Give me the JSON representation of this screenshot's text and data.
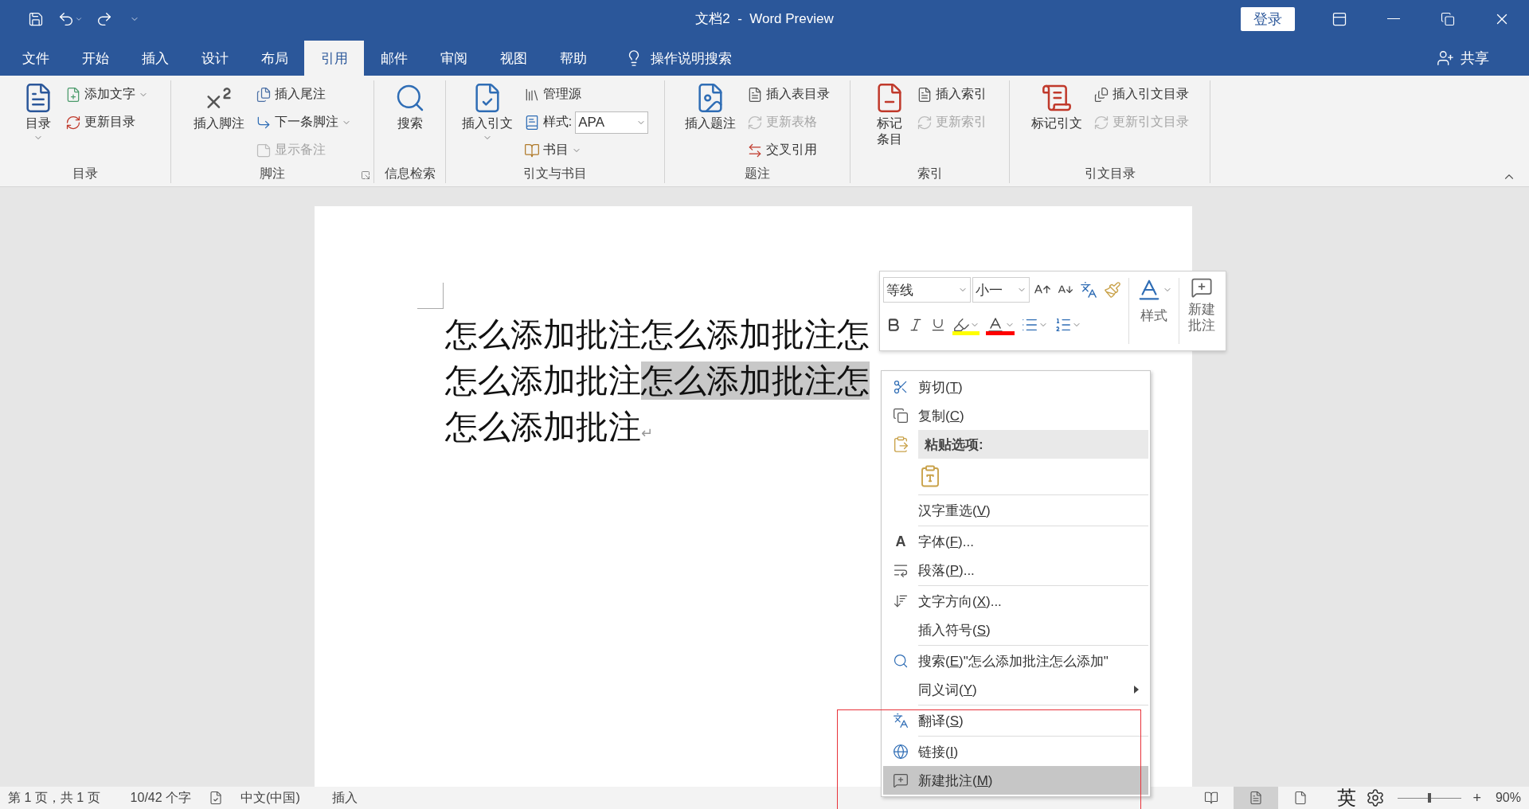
{
  "title_bar": {
    "title": "文档2  -  Word Preview",
    "sign_in": "登录"
  },
  "menu_tabs": [
    {
      "label": "文件",
      "selected": false
    },
    {
      "label": "开始",
      "selected": false
    },
    {
      "label": "插入",
      "selected": false
    },
    {
      "label": "设计",
      "selected": false
    },
    {
      "label": "布局",
      "selected": false
    },
    {
      "label": "引用",
      "selected": true
    },
    {
      "label": "邮件",
      "selected": false
    },
    {
      "label": "审阅",
      "selected": false
    },
    {
      "label": "视图",
      "selected": false
    },
    {
      "label": "帮助",
      "selected": false
    }
  ],
  "tell_me": "操作说明搜索",
  "share": "共享",
  "ribbon": {
    "groups": [
      {
        "label": "目录",
        "launcher": false,
        "items": [
          {
            "kind": "large",
            "label": "目录",
            "dropdown": true,
            "disabled": false
          },
          {
            "kind": "small",
            "label": "添加文字",
            "dropdown": true,
            "disabled": false
          },
          {
            "kind": "small",
            "label": "更新目录",
            "dropdown": false,
            "disabled": false
          }
        ]
      },
      {
        "label": "脚注",
        "launcher": true,
        "items": [
          {
            "kind": "large",
            "label": "插入脚注",
            "dropdown": false,
            "disabled": false
          },
          {
            "kind": "small",
            "label": "插入尾注",
            "dropdown": false,
            "disabled": false
          },
          {
            "kind": "small",
            "label": "下一条脚注",
            "dropdown": true,
            "disabled": false
          },
          {
            "kind": "small",
            "label": "显示备注",
            "dropdown": false,
            "disabled": true
          }
        ]
      },
      {
        "label": "信息检索",
        "launcher": false,
        "items": [
          {
            "kind": "large",
            "label": "搜索",
            "dropdown": false,
            "disabled": false
          }
        ]
      },
      {
        "label": "引文与书目",
        "launcher": false,
        "items": [
          {
            "kind": "large",
            "label": "插入引文",
            "dropdown": true,
            "disabled": false
          },
          {
            "kind": "small",
            "label": "管理源",
            "dropdown": false,
            "disabled": false
          },
          {
            "kind": "combo",
            "label": "样式:",
            "value": "APA",
            "dropdown": true,
            "disabled": false
          },
          {
            "kind": "small",
            "label": "书目",
            "dropdown": true,
            "disabled": false
          }
        ]
      },
      {
        "label": "题注",
        "launcher": false,
        "items": [
          {
            "kind": "large",
            "label": "插入题注",
            "dropdown": false,
            "disabled": false
          },
          {
            "kind": "small",
            "label": "插入表目录",
            "dropdown": false,
            "disabled": false
          },
          {
            "kind": "small",
            "label": "更新表格",
            "dropdown": false,
            "disabled": true
          },
          {
            "kind": "small",
            "label": "交叉引用",
            "dropdown": false,
            "disabled": false
          }
        ]
      },
      {
        "label": "索引",
        "launcher": false,
        "items": [
          {
            "kind": "large",
            "label": "标记条目",
            "dropdown": false,
            "disabled": false
          },
          {
            "kind": "small",
            "label": "插入索引",
            "dropdown": false,
            "disabled": false
          },
          {
            "kind": "small",
            "label": "更新索引",
            "dropdown": false,
            "disabled": true
          }
        ]
      },
      {
        "label": "引文目录",
        "launcher": false,
        "items": [
          {
            "kind": "large",
            "label": "标记引文",
            "dropdown": false,
            "disabled": false
          },
          {
            "kind": "small",
            "label": "插入引文目录",
            "dropdown": false,
            "disabled": false
          },
          {
            "kind": "small",
            "label": "更新引文目录",
            "dropdown": false,
            "disabled": true
          }
        ]
      }
    ]
  },
  "document": {
    "lines": [
      {
        "segments": [
          {
            "text": "怎么添加批注怎么添加批注怎",
            "selected": false
          }
        ]
      },
      {
        "segments": [
          {
            "text": "怎么添加批注",
            "selected": false
          },
          {
            "text": "怎么添加批注怎",
            "selected": true
          }
        ]
      },
      {
        "segments": [
          {
            "text": "怎么添加批注",
            "selected": false
          }
        ],
        "end_mark": "↵"
      }
    ]
  },
  "mini_toolbar": {
    "font": "等线",
    "size": "小一",
    "styles": "样式",
    "new_comment": "新建批注"
  },
  "context_menu": {
    "items": [
      {
        "kind": "item",
        "text": "剪切(",
        "hotkey": "T",
        "rest": ")",
        "selected": false,
        "submenu": false
      },
      {
        "kind": "item",
        "text": "复制(",
        "hotkey": "C",
        "rest": ")",
        "selected": false,
        "submenu": false
      },
      {
        "kind": "header",
        "text": "粘贴选项:"
      },
      {
        "kind": "paste_options"
      },
      {
        "kind": "separator"
      },
      {
        "kind": "item",
        "text": "汉字重选(",
        "hotkey": "V",
        "rest": ")",
        "selected": false,
        "submenu": false
      },
      {
        "kind": "separator"
      },
      {
        "kind": "item",
        "glyph": "A",
        "text": "字体(",
        "hotkey": "F",
        "rest": ")...",
        "selected": false,
        "submenu": false
      },
      {
        "kind": "item",
        "text": "段落(",
        "hotkey": "P",
        "rest": ")...",
        "selected": false,
        "submenu": false
      },
      {
        "kind": "separator"
      },
      {
        "kind": "item",
        "text": "文字方向(",
        "hotkey": "X",
        "rest": ")...",
        "selected": false,
        "submenu": false
      },
      {
        "kind": "item",
        "text": "插入符号(",
        "hotkey": "S",
        "rest": ")",
        "selected": false,
        "submenu": false
      },
      {
        "kind": "separator"
      },
      {
        "kind": "item",
        "text": "搜索(",
        "hotkey": "E",
        "rest": ")\"怎么添加批注怎么添加\"",
        "selected": false,
        "submenu": false
      },
      {
        "kind": "item",
        "text": "同义词(",
        "hotkey": "Y",
        "rest": ")",
        "selected": false,
        "submenu": true
      },
      {
        "kind": "separator"
      },
      {
        "kind": "item",
        "text": "翻译(",
        "hotkey": "S",
        "rest": ")",
        "selected": false,
        "submenu": false
      },
      {
        "kind": "separator"
      },
      {
        "kind": "item",
        "text": "链接(",
        "hotkey": "I",
        "rest": ")",
        "selected": false,
        "submenu": false
      },
      {
        "kind": "item",
        "text": "新建批注(",
        "hotkey": "M",
        "rest": ")",
        "selected": true,
        "submenu": false
      }
    ]
  },
  "annotation": {
    "kind": "rectangle"
  },
  "status_bar": {
    "page": "第 1 页，共 1 页",
    "words": "10/42 个字",
    "language": "中文(中国)",
    "mode": "插入",
    "views": [
      {
        "selected": false
      },
      {
        "selected": true
      },
      {
        "selected": false
      }
    ],
    "ime": "英",
    "zoom": {
      "level": 0.5,
      "zoom_in": "+",
      "value": "90%"
    }
  }
}
